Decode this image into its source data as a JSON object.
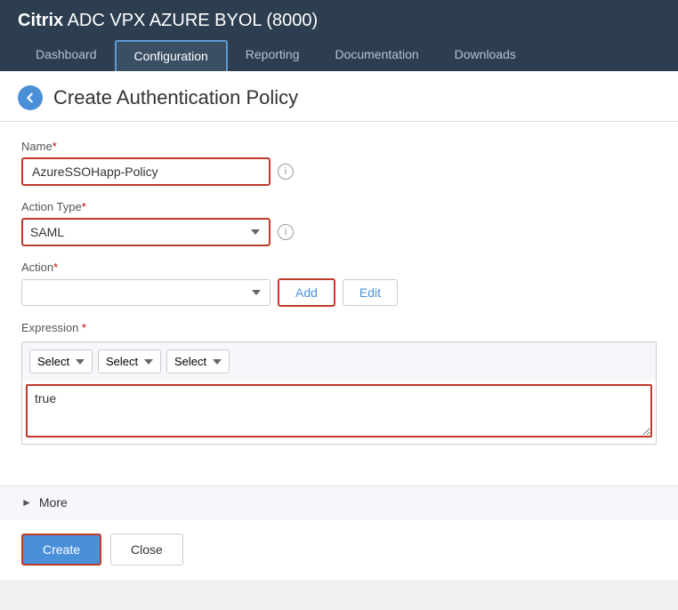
{
  "header": {
    "title": "ADC VPX AZURE BYOL (8000)",
    "title_brand": "Citrix",
    "nav": [
      {
        "label": "Dashboard",
        "active": false
      },
      {
        "label": "Configuration",
        "active": true
      },
      {
        "label": "Reporting",
        "active": false
      },
      {
        "label": "Documentation",
        "active": false
      },
      {
        "label": "Downloads",
        "active": false
      }
    ]
  },
  "page": {
    "title": "Create Authentication Policy",
    "back_label": "back"
  },
  "form": {
    "name_label": "Name",
    "name_value": "AzureSSOHapp-Policy",
    "action_type_label": "Action Type",
    "action_type_value": "SAML",
    "action_label": "Action",
    "add_button": "Add",
    "edit_button": "Edit",
    "expression_label": "Expression",
    "expr_select1": "Select",
    "expr_select2": "Select",
    "expr_select3": "Select",
    "expr_value": "true",
    "more_label": "More",
    "create_button": "Create",
    "close_button": "Close"
  }
}
